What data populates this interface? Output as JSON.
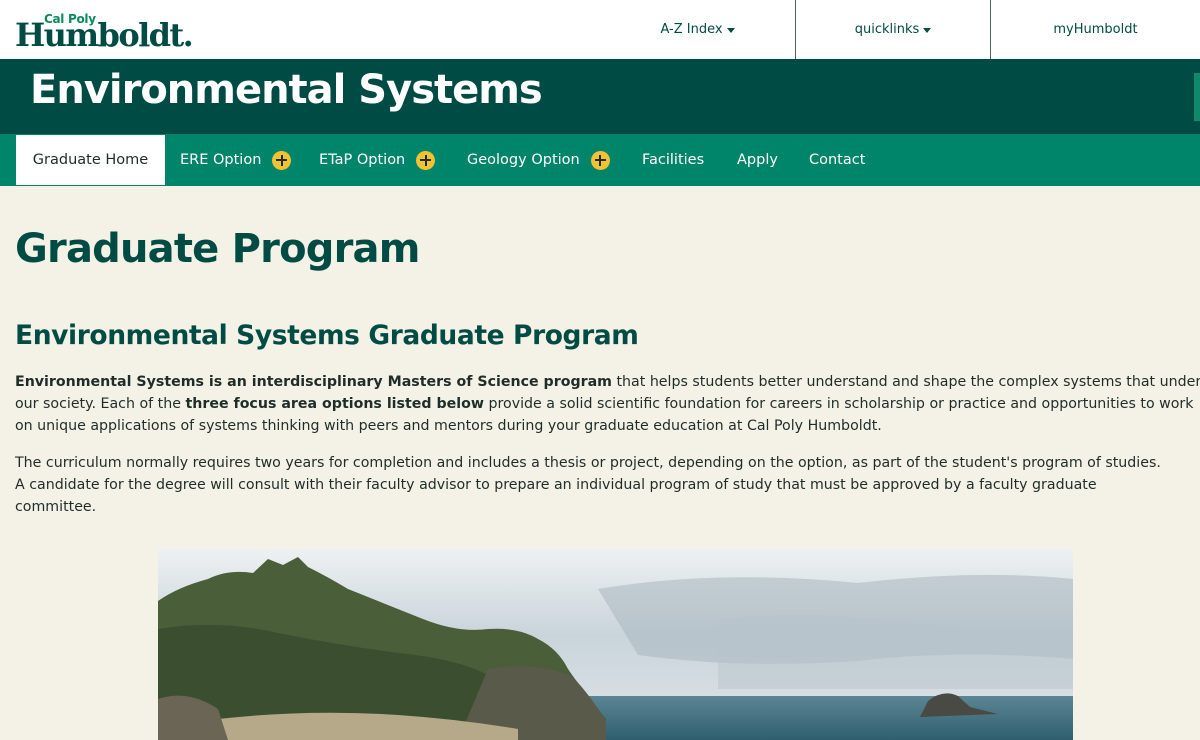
{
  "header": {
    "logo": {
      "small": "Cal Poly",
      "big": "Humboldt."
    },
    "utility_links": [
      {
        "label": "A-Z Index"
      },
      {
        "label": "quicklinks"
      },
      {
        "label": "myHumboldt"
      }
    ]
  },
  "site_title": "Environmental Systems",
  "nav": {
    "items": [
      {
        "label": "Graduate Home",
        "active": true
      },
      {
        "label": "ERE Option",
        "expandable": true
      },
      {
        "label": "ETaP Option",
        "expandable": true
      },
      {
        "label": "Geology Option",
        "expandable": true
      },
      {
        "label": "Facilities"
      },
      {
        "label": "Apply"
      },
      {
        "label": "Contact"
      }
    ]
  },
  "main": {
    "page_title": "Graduate Program",
    "section_title": "Environmental Systems Graduate Program",
    "paragraph1": {
      "line1_bold": "Environmental Systems is an interdisciplinary Masters of Science program",
      "line1_rest": " that helps students better understand and shape the complex systems that underp",
      "line2_start": "our society. Each of the ",
      "line2_bold": "three focus area options listed below",
      "line2_rest": " provide a solid scientific foundation for careers in scholarship or practice and opportunities to work",
      "line3": "on unique applications of systems thinking with peers and mentors during your graduate education at Cal Poly Humboldt."
    },
    "paragraph2": {
      "line1": "The curriculum normally requires two years for completion and includes a thesis or project, depending on the option, as part of the student's program of studies.",
      "line2": "A candidate for the degree will consult with their faculty advisor to prepare an individual program of study that must be approved by a faculty graduate",
      "line3": "committee."
    }
  },
  "colors": {
    "brand_dark": "#004c45",
    "nav_green": "#00856a",
    "accent_yellow": "#f2c230",
    "page_bg": "#f4f1e6"
  }
}
